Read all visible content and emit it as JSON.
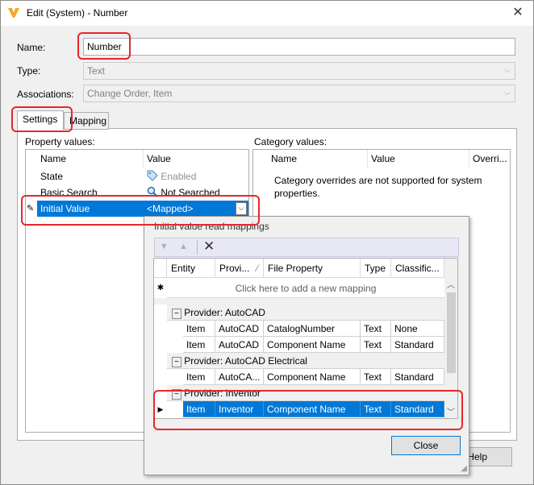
{
  "window": {
    "title": "Edit (System) - Number"
  },
  "form": {
    "name_label": "Name:",
    "name_value": "Number",
    "type_label": "Type:",
    "type_value": "Text",
    "associations_label": "Associations:",
    "associations_value": "Change Order, Item"
  },
  "tabs": [
    {
      "label": "Settings"
    },
    {
      "label": "Mapping"
    }
  ],
  "property_values": {
    "section_label": "Property values:",
    "columns": [
      "Name",
      "Value"
    ],
    "rows": [
      {
        "name": "State",
        "value": "Enabled",
        "icon": "tag-icon"
      },
      {
        "name": "Basic Search",
        "value": "Not Searched",
        "icon": "search-icon"
      },
      {
        "name": "Initial Value",
        "value": "<Mapped>"
      }
    ]
  },
  "category_values": {
    "section_label": "Category values:",
    "columns": [
      "Name",
      "Value",
      "Overri..."
    ],
    "message": "Category overrides are not supported for system properties."
  },
  "popup": {
    "title": "Initial value read mappings",
    "columns": [
      "Entity",
      "Provi...",
      "File Property",
      "Type",
      "Classific..."
    ],
    "add_row_text": "Click here to add a new mapping",
    "groups": [
      {
        "label": "Provider: AutoCAD",
        "rows": [
          [
            "Item",
            "AutoCAD",
            "CatalogNumber",
            "Text",
            "None"
          ],
          [
            "Item",
            "AutoCAD",
            "Component Name",
            "Text",
            "Standard"
          ]
        ]
      },
      {
        "label": "Provider: AutoCAD Electrical",
        "rows": [
          [
            "Item",
            "AutoCA...",
            "Component Name",
            "Text",
            "Standard"
          ]
        ]
      },
      {
        "label": "Provider: Inventor",
        "rows": [
          [
            "Item",
            "Inventor",
            "Component Name",
            "Text",
            "Standard"
          ]
        ]
      }
    ],
    "close_label": "Close"
  },
  "footer": {
    "help_label": "Help"
  },
  "colors": {
    "selection": "#0078d7",
    "highlight": "#e8262b"
  }
}
